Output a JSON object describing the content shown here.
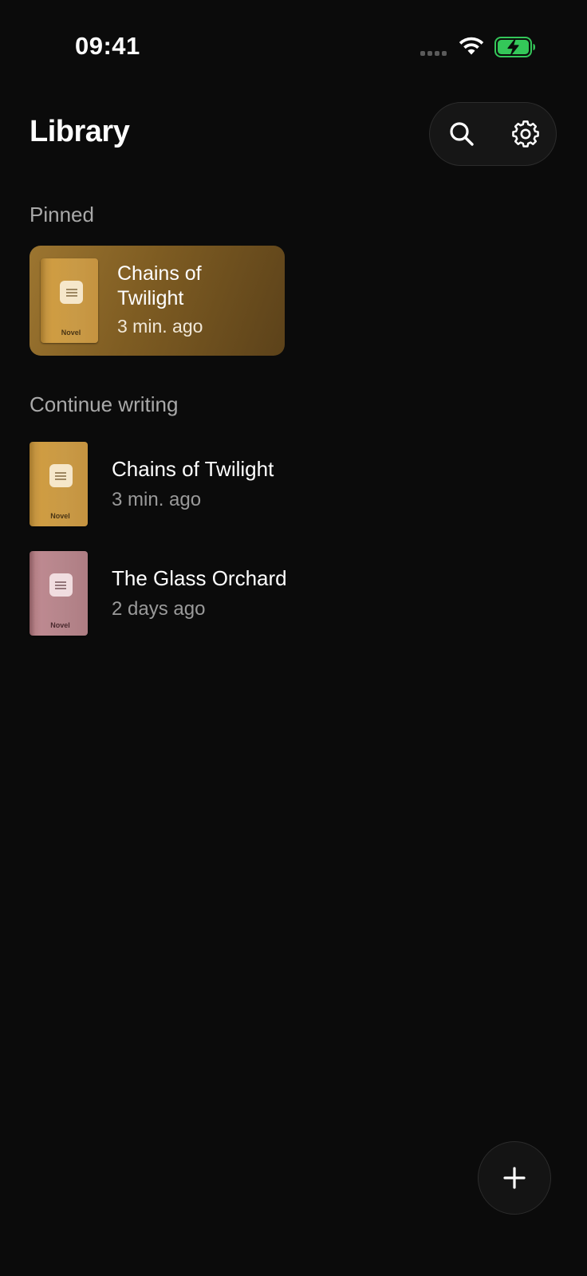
{
  "status_bar": {
    "time": "09:41"
  },
  "header": {
    "title": "Library",
    "search_icon": "search-icon",
    "settings_icon": "gear-icon"
  },
  "sections": {
    "pinned_label": "Pinned",
    "continue_label": "Continue writing"
  },
  "pinned": {
    "title": "Chains of Twilight",
    "time": "3 min. ago",
    "cover_label": "Novel",
    "cover_color": "#c99a46"
  },
  "continue_writing": [
    {
      "title": "Chains of Twilight",
      "time": "3 min. ago",
      "cover_label": "Novel",
      "cover_color": "#c99a46"
    },
    {
      "title": "The Glass Orchard",
      "time": "2 days ago",
      "cover_label": "Novel",
      "cover_color": "#b5858b"
    }
  ],
  "fab": {
    "icon": "plus-icon"
  },
  "colors": {
    "background": "#0b0b0b",
    "battery_fill": "#34c759",
    "secondary_text": "#9a9a9a"
  }
}
